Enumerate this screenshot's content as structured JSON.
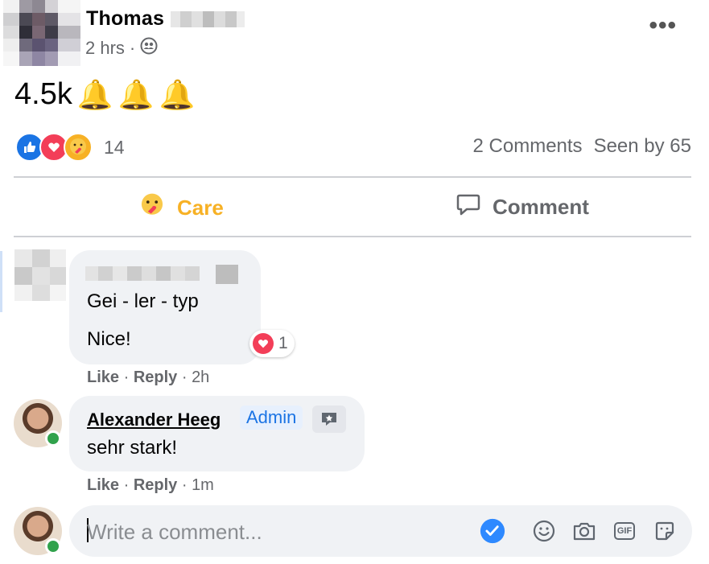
{
  "post": {
    "author": "Thomas",
    "time": "2 hrs",
    "separator": "·",
    "text": "4.5k",
    "emoji": [
      "🔔",
      "🔔",
      "🔔"
    ]
  },
  "reactions": {
    "count": "14",
    "icons": [
      "like-icon",
      "love-icon",
      "care-icon"
    ],
    "comments": "2 Comments",
    "seen": "Seen by 65"
  },
  "actions": {
    "care": "Care",
    "comment": "Comment",
    "care_color": "#f7b125"
  },
  "comments": [
    {
      "text_line1": "Gei - ler - typ",
      "text_line2": "Nice!",
      "reaction_count": "1",
      "like": "Like",
      "reply": "Reply",
      "time": "2h"
    },
    {
      "author": "Alexander Heeg",
      "badge": "Admin",
      "text": "sehr stark!",
      "like": "Like",
      "reply": "Reply",
      "time": "1m"
    }
  ],
  "composer": {
    "placeholder": "Write a comment...",
    "icons": [
      "check-icon",
      "emoji-icon",
      "camera-icon",
      "gif-icon",
      "sticker-icon"
    ],
    "gif_label": "GIF"
  },
  "colors": {
    "accent": "#1b74e4",
    "check": "#2e89ff",
    "online": "#31a24c"
  }
}
